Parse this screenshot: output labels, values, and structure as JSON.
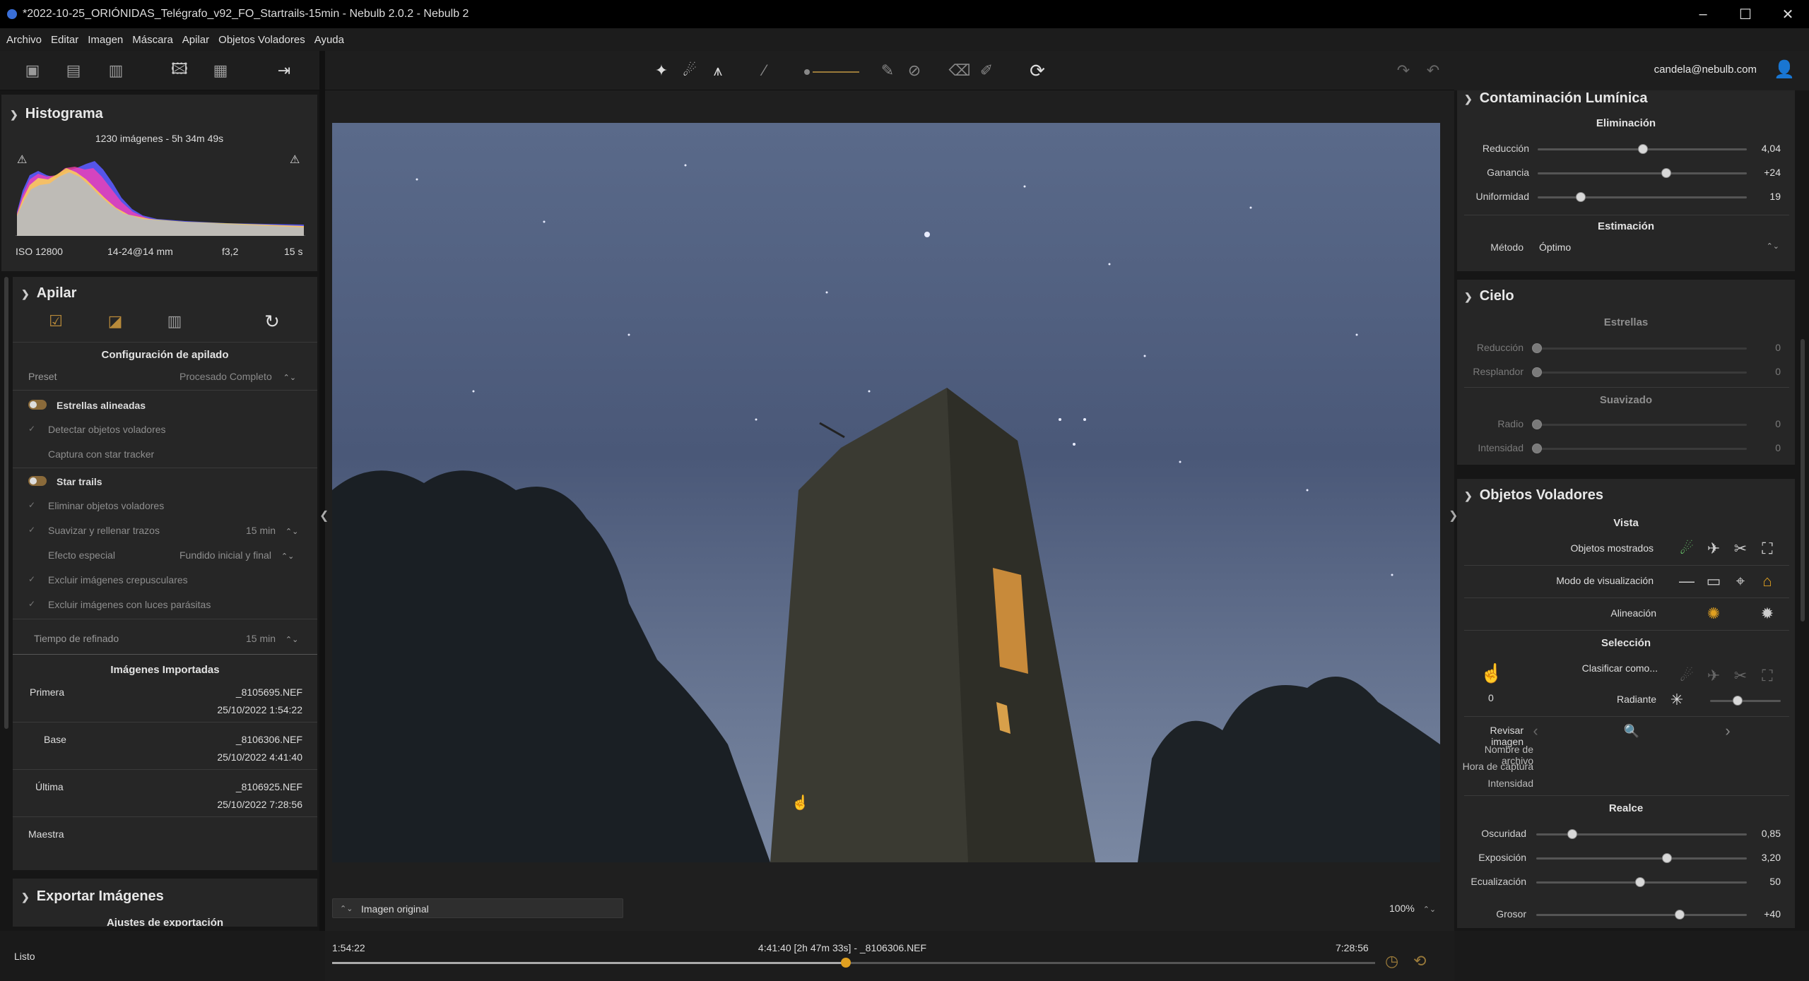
{
  "window": {
    "title": "*2022-10-25_ORIÓNIDAS_Telégrafo_v92_FO_Startrails-15min - Nebulb 2.0.2 - Nebulb 2"
  },
  "menu": [
    "Archivo",
    "Editar",
    "Imagen",
    "Máscara",
    "Apilar",
    "Objetos Voladores",
    "Ayuda"
  ],
  "user": {
    "email": "candela@nebulb.com"
  },
  "histogram": {
    "title": "Histograma",
    "summary": "1230 imágenes - 5h 34m 49s",
    "iso": "ISO 12800",
    "lens": "14-24@14 mm",
    "aperture": "f3,2",
    "exposure": "15 s"
  },
  "stack": {
    "title": "Apilar",
    "config_title": "Configuración de apilado",
    "preset_label": "Preset",
    "preset_value": "Procesado Completo",
    "aligned_stars": "Estrellas alineadas",
    "detect_flying": "Detectar objetos voladores",
    "star_tracker": "Captura con star tracker",
    "star_trails": "Star trails",
    "remove_flying": "Eliminar objetos voladores",
    "smooth_fill": "Suavizar y rellenar trazos",
    "smooth_fill_value": "15 min",
    "special_effect": "Efecto especial",
    "special_effect_value": "Fundido inicial y final",
    "exclude_twilight": "Excluir imágenes crepusculares",
    "exclude_parasitic": "Excluir imágenes con luces parásitas",
    "refine_time_label": "Tiempo de refinado",
    "refine_time_value": "15 min",
    "imported_title": "Imágenes Importadas",
    "imported": [
      {
        "label": "Primera",
        "file": "_8105695.NEF",
        "date": "25/10/2022 1:54:22"
      },
      {
        "label": "Base",
        "file": "_8106306.NEF",
        "date": "25/10/2022 4:41:40"
      },
      {
        "label": "Última",
        "file": "_8106925.NEF",
        "date": "25/10/2022 7:28:56"
      }
    ],
    "master_label": "Maestra"
  },
  "export": {
    "title": "Exportar Imágenes",
    "settings": "Ajustes de exportación"
  },
  "viewer": {
    "mode": "Imagen original",
    "zoom": "100%"
  },
  "timeline": {
    "start": "1:54:22",
    "center": "4:41:40 [2h 47m 33s] - _8106306.NEF",
    "end": "7:28:56",
    "position": 0.5
  },
  "status": {
    "text": "Listo"
  },
  "light_pollution": {
    "title": "Contaminación Lumínica",
    "removal_title": "Eliminación",
    "reduction_label": "Reducción",
    "reduction_value": "4,04",
    "reduction_level": 0.5,
    "gain_label": "Ganancia",
    "gain_value": "+24",
    "gain_level": 0.62,
    "uniformity_label": "Uniformidad",
    "uniformity_value": "19",
    "uniformity_level": 0.19,
    "estimation_title": "Estimación",
    "method_label": "Método",
    "method_value": "Óptimo"
  },
  "sky": {
    "title": "Cielo",
    "stars_title": "Estrellas",
    "reduction_label": "Reducción",
    "reduction_value": "0",
    "glow_label": "Resplandor",
    "glow_value": "0",
    "smoothing_title": "Suavizado",
    "radius_label": "Radio",
    "radius_value": "0",
    "intensity_label": "Intensidad",
    "intensity_value": "0"
  },
  "flying": {
    "title": "Objetos Voladores",
    "view_title": "Vista",
    "shown_label": "Objetos mostrados",
    "display_mode_label": "Modo de visualización",
    "alignment_label": "Alineación",
    "selection_title": "Selección",
    "classify_label": "Clasificar como...",
    "count": "0",
    "radiant_label": "Radiante",
    "review_label": "Revisar imagen",
    "filename_label": "Nombre de archivo",
    "capture_time_label": "Hora de captura",
    "intensity_label": "Intensidad",
    "enhance_title": "Realce",
    "darkness_label": "Oscuridad",
    "darkness_value": "0,85",
    "darkness_level": 0.17,
    "exposure_label": "Exposición",
    "exposure_value": "3,20",
    "exposure_level": 0.64,
    "equalization_label": "Ecualización",
    "equalization_value": "50",
    "equalization_level": 0.5,
    "thickness_label": "Grosor",
    "thickness_value": "+40",
    "thickness_level": 0.7
  },
  "colors": {
    "accent": "#e0a020",
    "green": "#6fd36f",
    "bg": "#161616",
    "panel": "#262626"
  }
}
